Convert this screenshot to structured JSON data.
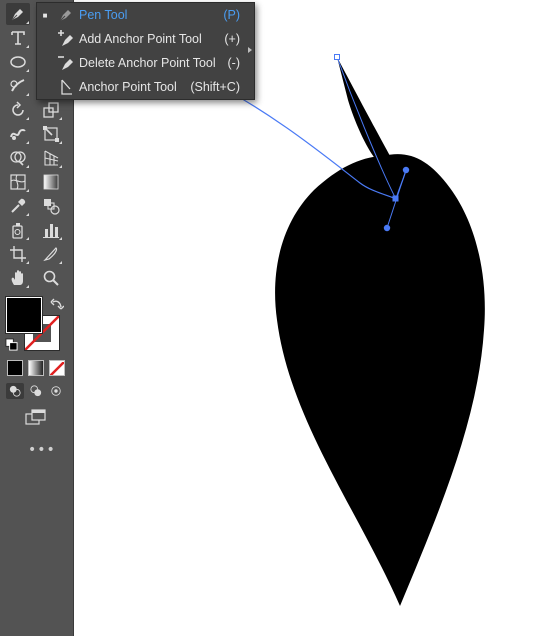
{
  "flyout": {
    "items": [
      {
        "label": "Pen Tool",
        "shortcut": "(P)",
        "selected": true,
        "icon": "pen-icon"
      },
      {
        "label": "Add Anchor Point Tool",
        "shortcut": "(+)",
        "selected": false,
        "icon": "add-anchor-point-icon"
      },
      {
        "label": "Delete Anchor Point Tool",
        "shortcut": "(-)",
        "selected": false,
        "icon": "delete-anchor-point-icon"
      },
      {
        "label": "Anchor Point Tool",
        "shortcut": "(Shift+C)",
        "selected": false,
        "icon": "anchor-point-icon"
      }
    ]
  },
  "toolbar": {
    "tools": [
      "pen-icon",
      "type-icon",
      "ellipse-icon",
      "pencil-brush-icon",
      "rotate-icon",
      "scale-icon",
      "warp-icon",
      "free-transform-icon",
      "shape-builder-icon",
      "perspective-grid-icon",
      "mesh-icon",
      "gradient-icon",
      "eyedropper-icon",
      "blend-icon",
      "symbol-sprayer-icon",
      "column-graph-icon",
      "artboard-icon",
      "slice-icon",
      "hand-icon",
      "zoom-icon"
    ],
    "fill_color": "#000000",
    "stroke": "none",
    "more_label": "•••"
  },
  "colors": {
    "selection_blue": "#4a7af5",
    "toolbar_bg": "#535353",
    "flyout_bg": "#424242",
    "highlight_text": "#4a9df2"
  }
}
